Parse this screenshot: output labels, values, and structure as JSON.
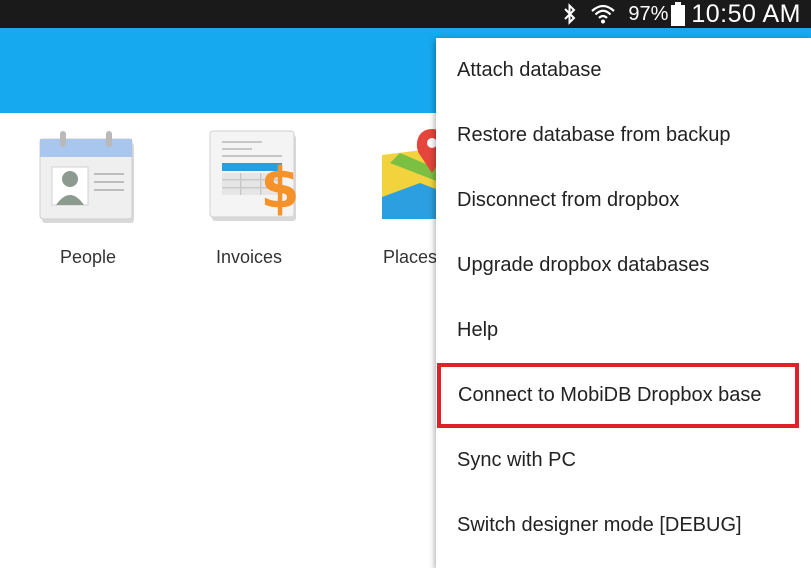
{
  "status_bar": {
    "icons": [
      "bluetooth-icon",
      "wifi-icon",
      "battery-icon"
    ],
    "battery_percent": "97%",
    "time": "10:50 AM"
  },
  "app_bar": {
    "color": "#16a9ef"
  },
  "tiles": [
    {
      "label": "People",
      "icon": "people-contact-card-icon"
    },
    {
      "label": "Invoices",
      "icon": "invoice-dollar-icon"
    },
    {
      "label": "Places",
      "icon": "map-pin-icon"
    }
  ],
  "overflow_menu": {
    "items": [
      {
        "label": "Attach database"
      },
      {
        "label": "Restore database from backup"
      },
      {
        "label": "Disconnect from dropbox"
      },
      {
        "label": "Upgrade dropbox databases"
      },
      {
        "label": "Help"
      },
      {
        "label": "Connect to MobiDB Dropbox base",
        "highlighted": true,
        "highlight_color": "#e0202b"
      },
      {
        "label": "Sync with PC"
      },
      {
        "label": "Switch designer mode [DEBUG]"
      }
    ]
  }
}
